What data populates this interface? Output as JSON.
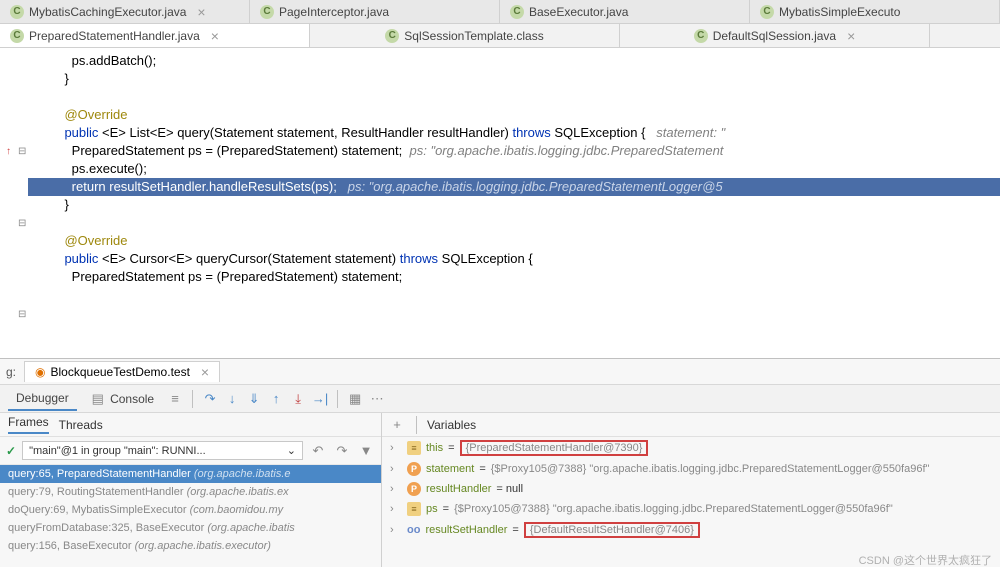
{
  "tabs_row1": [
    {
      "label": "MybatisCachingExecutor.java",
      "active": false
    },
    {
      "label": "PageInterceptor.java",
      "active": false
    },
    {
      "label": "BaseExecutor.java",
      "active": false
    },
    {
      "label": "MybatisSimpleExecuto",
      "active": false
    }
  ],
  "tabs_row2": [
    {
      "label": "PreparedStatementHandler.java",
      "active": true
    },
    {
      "label": "SqlSessionTemplate.class",
      "active": false
    },
    {
      "label": "DefaultSqlSession.java",
      "active": false
    }
  ],
  "code": {
    "l1": "      ps.addBatch();",
    "l2": "    }",
    "l4": "    @Override",
    "l5a": "    public",
    "l5b": " <E> List<E> query(Statement statement, ResultHandler resultHandler) ",
    "l5c": "throws",
    "l5d": " SQLException {   ",
    "l5e": "statement: \"",
    "l6a": "      PreparedStatement ps = (PreparedStatement) statement;  ",
    "l6b": "ps: \"org.apache.ibatis.logging.jdbc.PreparedStatement",
    "l7": "      ps.execute();",
    "l8a": "      return",
    "l8b": " resultSetHandler.handleResultSets(ps);   ",
    "l8c": "ps: \"org.apache.ibatis.logging.jdbc.PreparedStatementLogger@5",
    "l9": "    }",
    "l11": "    @Override",
    "l12a": "    public",
    "l12b": " <E> Cursor<E> queryCursor(Statement statement) ",
    "l12c": "throws",
    "l12d": " SQLException {",
    "l13": "      PreparedStatement ps = (PreparedStatement) statement;"
  },
  "debug": {
    "label_prefix": "g:",
    "run_config": "BlockqueueTestDemo.test",
    "tab_debugger": "Debugger",
    "tab_console": "Console",
    "frames_tab": "Frames",
    "threads_tab": "Threads",
    "thread": "\"main\"@1 in group \"main\": RUNNI...",
    "frames": [
      {
        "m": "query:65, PreparedStatementHandler ",
        "p": "(org.apache.ibatis.e",
        "sel": true
      },
      {
        "m": "query:79, RoutingStatementHandler ",
        "p": "(org.apache.ibatis.ex",
        "sel": false
      },
      {
        "m": "doQuery:69, MybatisSimpleExecutor ",
        "p": "(com.baomidou.my",
        "sel": false
      },
      {
        "m": "queryFromDatabase:325, BaseExecutor ",
        "p": "(org.apache.ibatis",
        "sel": false
      },
      {
        "m": "query:156, BaseExecutor ",
        "p": "(org.apache.ibatis.executor)",
        "sel": false
      }
    ],
    "vars_header": "Variables",
    "variables": [
      {
        "ic": "e",
        "name": "this",
        "eq": " = ",
        "val": "{PreparedStatementHandler@7390}",
        "box": true
      },
      {
        "ic": "p",
        "name": "statement",
        "eq": " = ",
        "val": "{$Proxy105@7388} \"org.apache.ibatis.logging.jdbc.PreparedStatementLogger@550fa96f\"",
        "box": false
      },
      {
        "ic": "p",
        "name": "resultHandler",
        "eq": " = null",
        "val": "",
        "box": false
      },
      {
        "ic": "e",
        "name": "ps",
        "eq": " = ",
        "val": "{$Proxy105@7388} \"org.apache.ibatis.logging.jdbc.PreparedStatementLogger@550fa96f\"",
        "box": false
      },
      {
        "ic": "oo",
        "name": "resultSetHandler",
        "eq": " = ",
        "val": "{DefaultResultSetHandler@7406}",
        "box": true
      }
    ]
  },
  "watermark": "CSDN @这个世界太疯狂了"
}
